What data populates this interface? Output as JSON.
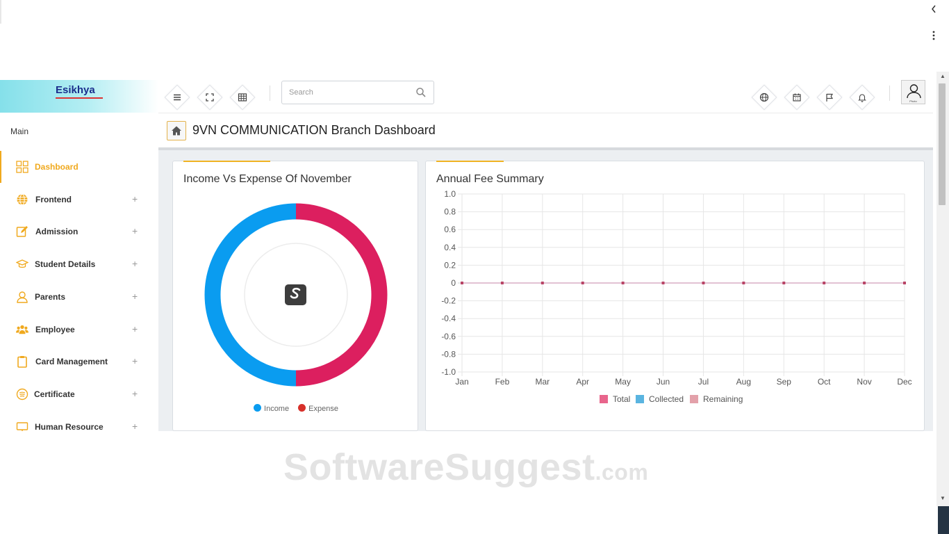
{
  "brand": {
    "name": "Esikhya"
  },
  "header": {
    "search_placeholder": "Search",
    "avatar_label": "Photo"
  },
  "sidebar": {
    "heading": "Main",
    "items": [
      {
        "label": "Dashboard",
        "icon": "grid-icon",
        "active": true
      },
      {
        "label": "Frontend",
        "icon": "globe-icon",
        "expand": "+"
      },
      {
        "label": "Admission",
        "icon": "edit-icon",
        "expand": "+"
      },
      {
        "label": "Student Details",
        "icon": "graduation-cap-icon",
        "expand": "+"
      },
      {
        "label": "Parents",
        "icon": "user-icon",
        "expand": "+"
      },
      {
        "label": "Employee",
        "icon": "users-icon",
        "expand": "+"
      },
      {
        "label": "Card Management",
        "icon": "clipboard-icon",
        "expand": "+"
      },
      {
        "label": "Certificate",
        "icon": "certificate-icon",
        "expand": "+"
      },
      {
        "label": "Human Resource",
        "icon": "monitor-icon",
        "expand": "+"
      }
    ]
  },
  "page": {
    "title": "9VN COMMUNICATION Branch Dashboard"
  },
  "colors": {
    "accent": "#f0a91e",
    "income": "#0a9cf0",
    "expense": "#dc1f5f",
    "total": "#e8658c",
    "collected": "#5ab4e0",
    "remaining": "#e3a1aa"
  },
  "income_card": {
    "title": "Income Vs Expense Of November",
    "legend": [
      "Income",
      "Expense"
    ]
  },
  "fee_card": {
    "title": "Annual Fee Summary",
    "legend": [
      "Total",
      "Collected",
      "Remaining"
    ]
  },
  "chart_data": [
    {
      "type": "pie",
      "title": "Income Vs Expense Of November",
      "labels": [
        "Income",
        "Expense"
      ],
      "values": [
        50,
        50
      ],
      "legend_position": "bottom"
    },
    {
      "type": "line",
      "title": "Annual Fee Summary",
      "categories": [
        "Jan",
        "Feb",
        "Mar",
        "Apr",
        "May",
        "Jun",
        "Jul",
        "Aug",
        "Sep",
        "Oct",
        "Nov",
        "Dec"
      ],
      "series": [
        {
          "name": "Total",
          "values": [
            0,
            0,
            0,
            0,
            0,
            0,
            0,
            0,
            0,
            0,
            0,
            0
          ]
        },
        {
          "name": "Collected",
          "values": [
            0,
            0,
            0,
            0,
            0,
            0,
            0,
            0,
            0,
            0,
            0,
            0
          ]
        },
        {
          "name": "Remaining",
          "values": [
            0,
            0,
            0,
            0,
            0,
            0,
            0,
            0,
            0,
            0,
            0,
            0
          ]
        }
      ],
      "ylim": [
        -1.0,
        1.0
      ],
      "yticks": [
        "1.0",
        "0.8",
        "0.6",
        "0.4",
        "0.2",
        "0",
        "-0.2",
        "-0.4",
        "-0.6",
        "-0.8",
        "-1.0"
      ],
      "grid": true,
      "legend_position": "bottom"
    }
  ],
  "watermark": {
    "text": "SoftwareSuggest",
    "suffix": ".com"
  }
}
